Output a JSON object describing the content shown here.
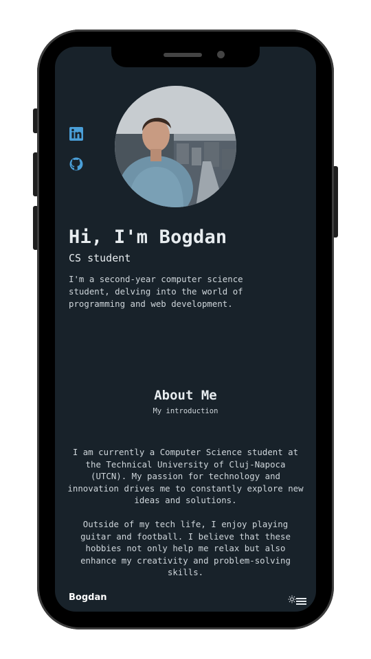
{
  "hero": {
    "title": "Hi, I'm Bogdan",
    "subtitle": "CS student",
    "description": "I'm a second-year computer science student, delving into the world of programming and web development."
  },
  "social": [
    {
      "name": "linkedin-icon"
    },
    {
      "name": "github-icon"
    }
  ],
  "about": {
    "title": "About Me",
    "subtitle": "My introduction",
    "paragraphs": [
      "I am currently a Computer Science student at the Technical University of Cluj-Napoca (UTCN). My passion for technology and innovation drives me to constantly explore new ideas and solutions.",
      "Outside of my tech life, I enjoy playing guitar and football. I believe that these hobbies not only help me relax but also enhance my creativity and problem-solving skills."
    ]
  },
  "footer": {
    "brand": "Bogdan"
  },
  "colors": {
    "background": "#18222a",
    "text": "#e7ecef",
    "accent": "#4a9fd8"
  }
}
